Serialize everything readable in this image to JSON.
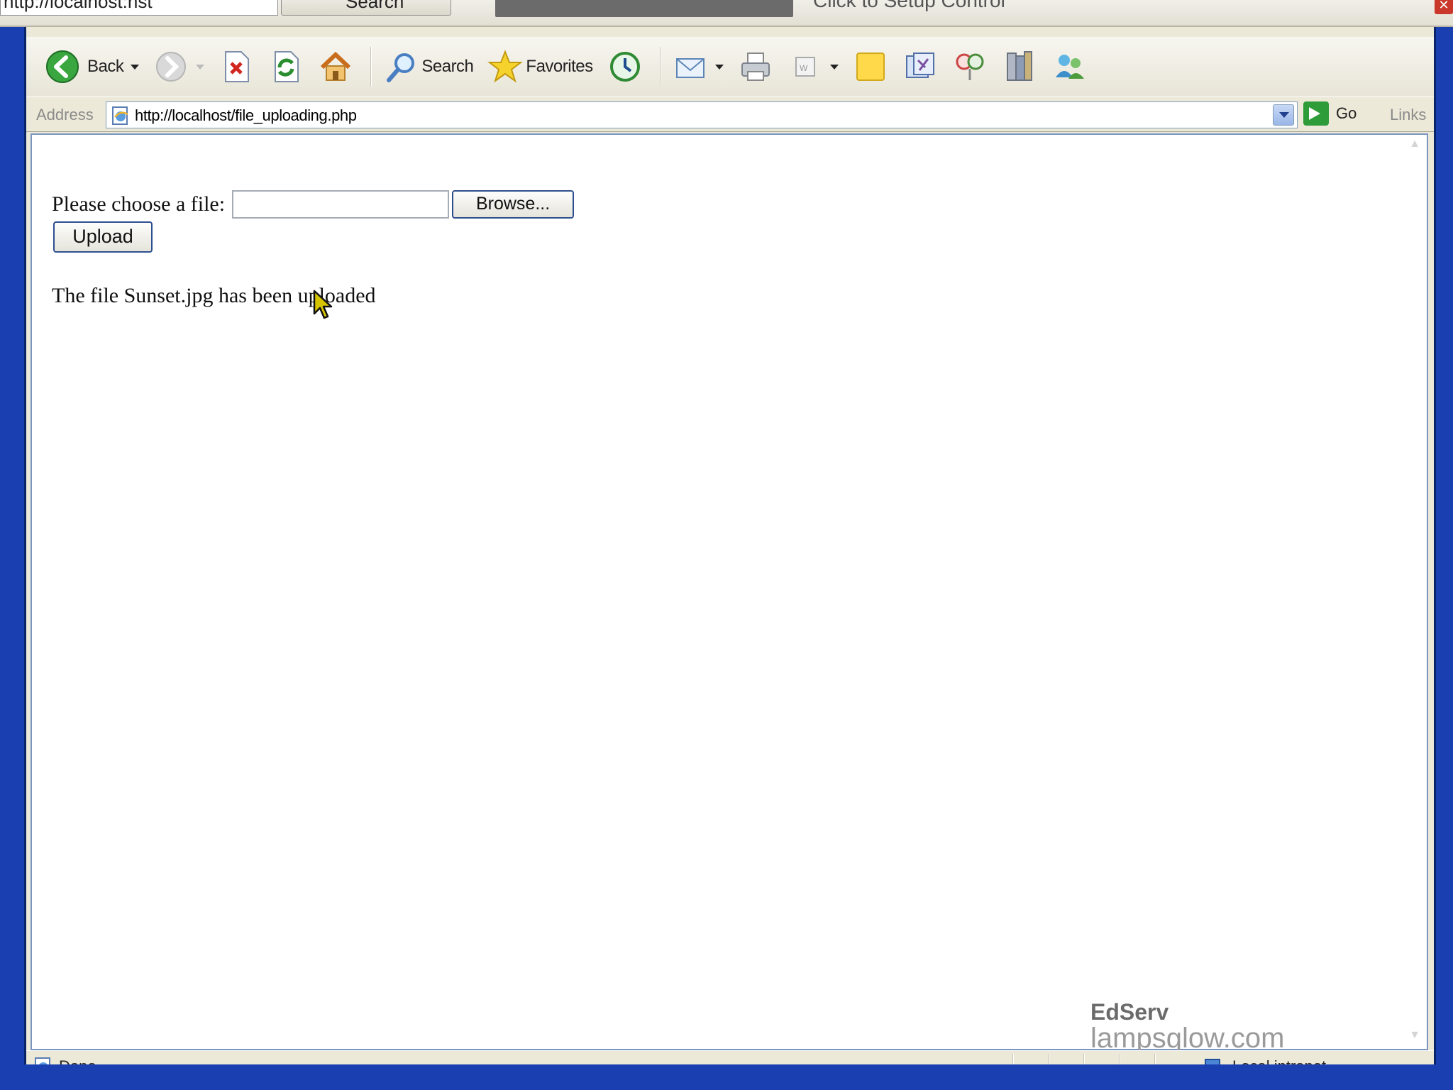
{
  "outer": {
    "url_fragment": "http://localhost:nst",
    "search_fragment": "Search",
    "hint_fragment": "Click to Setup Control"
  },
  "toolbar": {
    "back_label": "Back",
    "search_label": "Search",
    "favorites_label": "Favorites"
  },
  "address": {
    "label": "Address",
    "url": "http://localhost/file_uploading.php",
    "go_label": "Go",
    "links_label": "Links"
  },
  "page": {
    "file_prompt": "Please choose a file:",
    "browse_label": "Browse...",
    "upload_label": "Upload",
    "message": "The file Sunset.jpg has been uploaded"
  },
  "watermark": {
    "brand": "EdServ",
    "site": "lampsglow.com"
  },
  "status": {
    "text": "Done",
    "zone": "Local intranet"
  },
  "colors": {
    "title_blue": "#0a246a",
    "desktop_blue": "#1a3fb0",
    "chrome": "#ece9d8",
    "button_border": "#2e4f8f"
  }
}
